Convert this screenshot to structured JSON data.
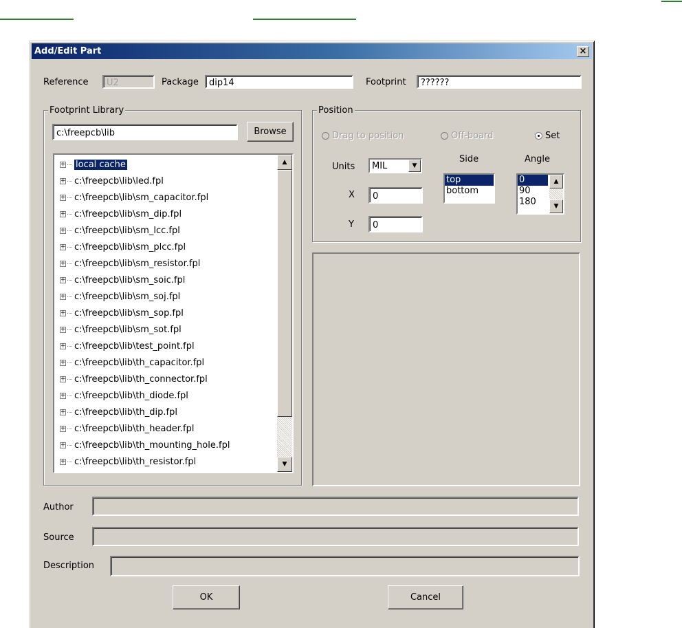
{
  "dialog": {
    "title": "Add/Edit Part",
    "close_label": "×"
  },
  "fields": {
    "reference_label": "Reference",
    "reference_value": "U2",
    "package_label": "Package",
    "package_value": "dip14",
    "footprint_label": "Footprint",
    "footprint_value": "??????"
  },
  "library": {
    "group_label": "Footprint Library",
    "path_value": "c:\\freepcb\\lib",
    "browse_label": "Browse",
    "items": [
      "local cache",
      "c:\\freepcb\\lib\\led.fpl",
      "c:\\freepcb\\lib\\sm_capacitor.fpl",
      "c:\\freepcb\\lib\\sm_dip.fpl",
      "c:\\freepcb\\lib\\sm_lcc.fpl",
      "c:\\freepcb\\lib\\sm_plcc.fpl",
      "c:\\freepcb\\lib\\sm_resistor.fpl",
      "c:\\freepcb\\lib\\sm_soic.fpl",
      "c:\\freepcb\\lib\\sm_soj.fpl",
      "c:\\freepcb\\lib\\sm_sop.fpl",
      "c:\\freepcb\\lib\\sm_sot.fpl",
      "c:\\freepcb\\lib\\test_point.fpl",
      "c:\\freepcb\\lib\\th_capacitor.fpl",
      "c:\\freepcb\\lib\\th_connector.fpl",
      "c:\\freepcb\\lib\\th_diode.fpl",
      "c:\\freepcb\\lib\\th_dip.fpl",
      "c:\\freepcb\\lib\\th_header.fpl",
      "c:\\freepcb\\lib\\th_mounting_hole.fpl",
      "c:\\freepcb\\lib\\th_resistor.fpl"
    ],
    "selected_index": 0
  },
  "position": {
    "group_label": "Position",
    "drag_label": "Drag to position",
    "offboard_label": "Off-board",
    "set_label": "Set",
    "units_label": "Units",
    "units_value": "MIL",
    "x_label": "X",
    "x_value": "0",
    "y_label": "Y",
    "y_value": "0",
    "side_label": "Side",
    "side_options": [
      "top",
      "bottom"
    ],
    "angle_label": "Angle",
    "angle_options": [
      "0",
      "90",
      "180"
    ]
  },
  "meta": {
    "author_label": "Author",
    "source_label": "Source",
    "description_label": "Description"
  },
  "buttons": {
    "ok_label": "OK",
    "cancel_label": "Cancel"
  },
  "colors": {
    "selection": "#0a246a",
    "face": "#d4d0c8",
    "accent_lines": "#2e7d32"
  },
  "icons": {
    "expander": "plus-box-icon",
    "scroll_up": "triangle-up-icon",
    "scroll_down": "triangle-down-icon",
    "dropdown": "triangle-down-icon"
  }
}
